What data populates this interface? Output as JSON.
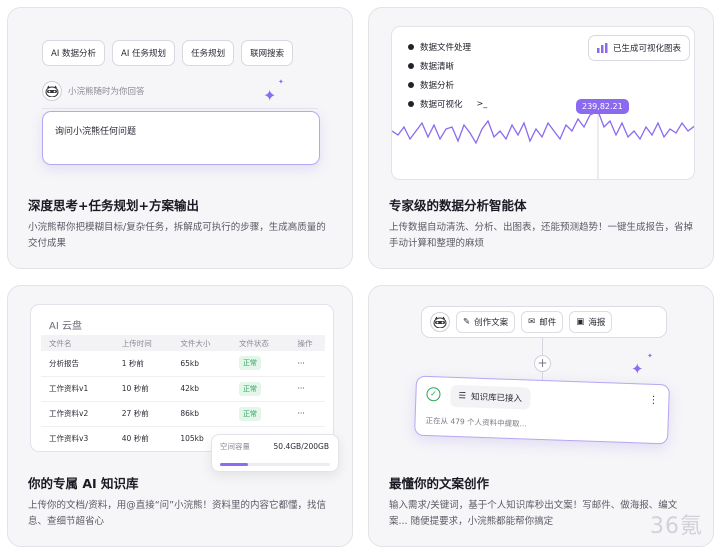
{
  "card1": {
    "chips": [
      "AI 数据分析",
      "AI 任务规划",
      "任务规划",
      "联网搜索"
    ],
    "assistant_hint": "小浣熊随时为你回答",
    "prompt_placeholder": "询问小浣熊任何问题",
    "title": "深度思考+任务规划+方案输出",
    "desc": "小浣熊帮你把模糊目标/复杂任务，拆解成可执行的步骤，生成高质量的交付成果"
  },
  "card2": {
    "steps": [
      "数据文件处理",
      "数据清晰",
      "数据分析",
      "数据可视化"
    ],
    "viz_button": "已生成可视化图表",
    "tooltip_value": "239,82.21",
    "title": "专家级的数据分析智能体",
    "desc": "上传数据自动清洗、分析、出图表，还能预测趋势！一键生成报告，省掉手动计算和整理的麻烦"
  },
  "card3": {
    "panel_title": "AI 云盘",
    "columns": [
      "文件名",
      "上传时间",
      "文件大小",
      "文件状态",
      "操作"
    ],
    "rows": [
      {
        "name": "分析报告",
        "time": "1 秒前",
        "size": "65kb",
        "status": "正常",
        "op": "···"
      },
      {
        "name": "工作资料v1",
        "time": "10 秒前",
        "size": "42kb",
        "status": "正常",
        "op": "···"
      },
      {
        "name": "工作资料v2",
        "time": "27 秒前",
        "size": "86kb",
        "status": "正常",
        "op": "···"
      },
      {
        "name": "工作资料v3",
        "time": "40 秒前",
        "size": "105kb",
        "status": "",
        "op": ""
      }
    ],
    "storage_label": "空间容量",
    "storage_value": "50.4GB/200GB",
    "storage_fraction": 0.252,
    "title": "你的专属 AI 知识库",
    "desc": "上传你的文档/资料，用@直接“问”小浣熊！资料里的内容它都懂，找信息、查细节超省心"
  },
  "card4": {
    "tools": [
      "创作文案",
      "邮件",
      "海报"
    ],
    "kb_status": "知识库已接入",
    "kb_sub": "正在从 479 个人资料中提取...",
    "title": "最懂你的文案创作",
    "desc": "输入需求/关键词，基于个人知识库秒出文案！写邮件、做海报、编文案... 随便提要求，小浣熊都能帮你搞定"
  },
  "watermark": "36氪",
  "colors": {
    "accent": "#8b6af0",
    "success": "#2da45a"
  }
}
